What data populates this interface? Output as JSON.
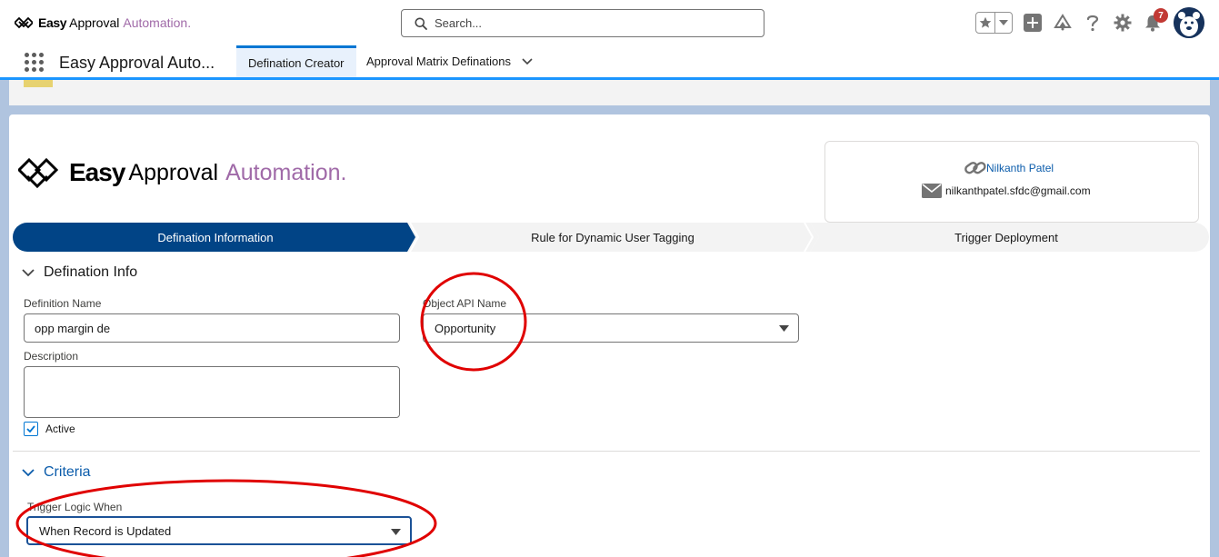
{
  "header": {
    "logo": {
      "word1": "Easy",
      "word2": "Approval",
      "word3": "Automation."
    },
    "search": {
      "placeholder": "Search..."
    },
    "icons": [
      "favorites-star-icon",
      "favorites-dropdown-icon",
      "add-icon",
      "trailhead-icon",
      "help-icon",
      "setup-gear-icon",
      "notifications-bell-icon",
      "avatar"
    ],
    "notification_count": "7"
  },
  "nav": {
    "app_name": "Easy Approval Auto...",
    "tabs": [
      {
        "label": "Defination Creator",
        "active": true
      },
      {
        "label": "Approval Matrix Definations",
        "active": false
      }
    ]
  },
  "card": {
    "logo": {
      "word1": "Easy",
      "word2": "Approval",
      "word3": "Automation."
    },
    "author": {
      "name": "Nilkanth Patel",
      "email": "nilkanthpatel.sfdc@gmail.com"
    },
    "path": [
      {
        "label": "Defination Information",
        "active": true
      },
      {
        "label": "Rule for Dynamic User Tagging",
        "active": false
      },
      {
        "label": "Trigger Deployment",
        "active": false
      }
    ],
    "defination_info": {
      "title": "Defination Info",
      "definition_name_label": "Definition Name",
      "definition_name_value": "opp margin de",
      "object_api_label": "Object API Name",
      "object_api_value": "Opportunity",
      "description_label": "Description",
      "description_value": "",
      "active_label": "Active",
      "active_checked": true
    },
    "criteria": {
      "title": "Criteria",
      "trigger_label": "Trigger Logic When",
      "trigger_value": "When Record is Updated"
    }
  },
  "colors": {
    "brand_purple": "#a06aa8",
    "path_active": "#014486",
    "annotation_red": "#e00000",
    "link_blue": "#0b5cab"
  }
}
